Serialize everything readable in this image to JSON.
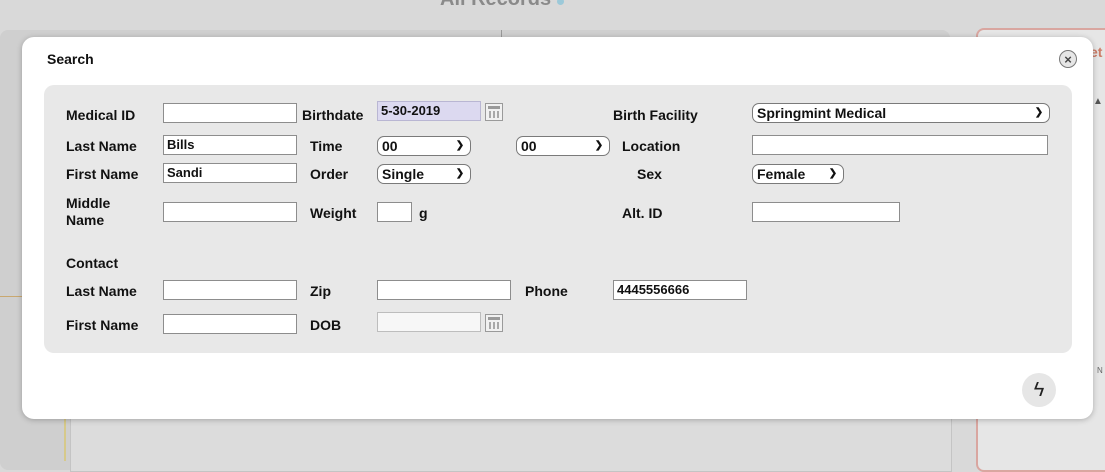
{
  "background": {
    "title": "All Records",
    "side_text": "N"
  },
  "modal": {
    "title": "Search",
    "close_icon": "close-circle-icon",
    "search_icon": "lightning-bolt-icon"
  },
  "labels": {
    "medical_id": "Medical ID",
    "birthdate": "Birthdate",
    "birth_facility": "Birth Facility",
    "last_name": "Last Name",
    "time": "Time",
    "location": "Location",
    "first_name": "First Name",
    "order": "Order",
    "sex": "Sex",
    "middle_name_1": "Middle",
    "middle_name_2": "Name",
    "weight": "Weight",
    "weight_unit": "g",
    "alt_id": "Alt. ID",
    "contact": "Contact",
    "contact_last_name": "Last Name",
    "zip": "Zip",
    "phone": "Phone",
    "contact_first_name": "First Name",
    "dob": "DOB"
  },
  "values": {
    "medical_id": "",
    "birthdate": "5-30-2019",
    "birth_facility": "Springmint Medical",
    "last_name": "Bills",
    "time_hour": "00",
    "time_minute": "00",
    "location": "",
    "first_name": "Sandi",
    "order": "Single",
    "sex": "Female",
    "middle_name": "",
    "weight": "",
    "alt_id": "",
    "contact_last_name": "",
    "zip": "",
    "phone": "4445556666",
    "contact_first_name": "",
    "dob": ""
  },
  "colors": {
    "date_field": "#dcd9f0",
    "panel": "#e8e8e8"
  }
}
